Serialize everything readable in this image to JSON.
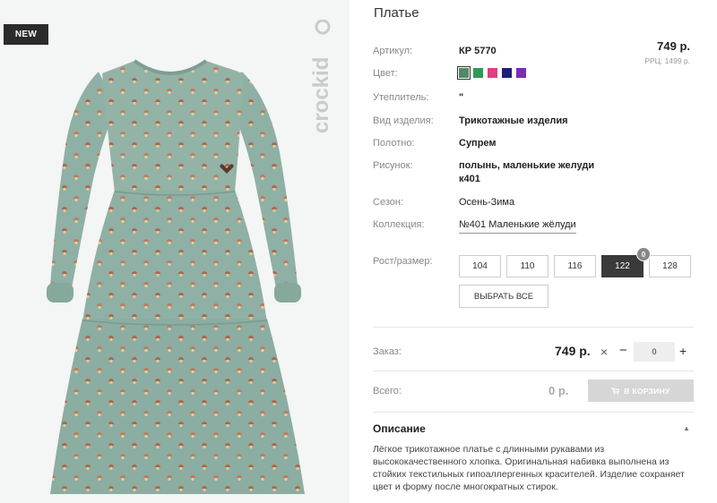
{
  "product": {
    "badge": "NEW",
    "brand_watermark": "crockid",
    "title": "Платье",
    "price": "749 р.",
    "rrp": "РРЦ: 1499 р."
  },
  "attributes": {
    "article_label": "Артикул:",
    "article_value": "КР 5770",
    "color_label": "Цвет:",
    "filler_label": "Утеплитель:",
    "filler_value": "\"",
    "kind_label": "Вид изделия:",
    "kind_value": "Трикотажные изделия",
    "fabric_label": "Полотно:",
    "fabric_value": "Супрем",
    "pattern_label": "Рисунок:",
    "pattern_value_line1": "полынь, маленькие желуди",
    "pattern_value_line2": "к401",
    "season_label": "Сезон:",
    "season_value": "Осень-Зима",
    "collection_label": "Коллекция:",
    "collection_value": "№401 Маленькие жёлуди"
  },
  "colors": [
    "#4e8a67",
    "#2e9a55",
    "#e03e7e",
    "#1d1f7a",
    "#7a2db0"
  ],
  "sizes": {
    "label": "Рост/размер:",
    "options": [
      "104",
      "110",
      "116",
      "122",
      "128"
    ],
    "selected": "122",
    "selected_count": "0",
    "select_all": "ВЫБРАТЬ ВСЕ"
  },
  "order": {
    "label": "Заказ:",
    "price": "749 р.",
    "times": "×",
    "minus": "−",
    "quantity": "0",
    "plus": "+"
  },
  "total": {
    "label": "Всего:",
    "value": "0 р.",
    "cart_button": "В КОРЗИНУ"
  },
  "description": {
    "title": "Описание",
    "toggle": "▲",
    "text": "Лёгкое трикотажное платье с длинными рукавами из высококачественного хлопка. Оригинальная набивка выполнена из стойких текстильных гипоаллергенных красителей. Изделие сохраняет цвет и форму после многократных стирок."
  }
}
